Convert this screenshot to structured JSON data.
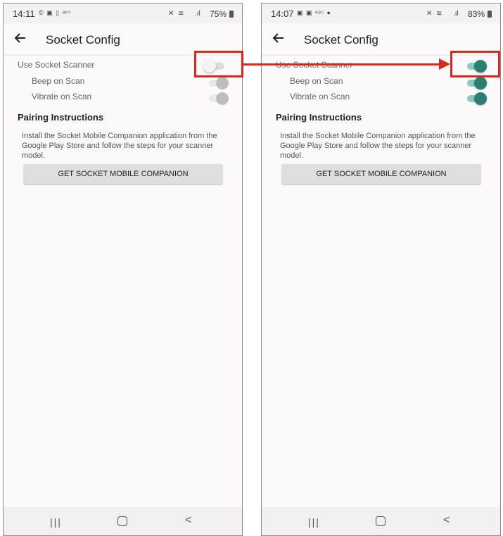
{
  "left": {
    "status": {
      "time": "14:11",
      "battery": "75%",
      "left_icons": "© ▣ ▯ ᵃᵖᶜ"
    },
    "toggles": {
      "use_scanner": "off",
      "beep": "disabled",
      "vibrate": "disabled"
    }
  },
  "right": {
    "status": {
      "time": "14:07",
      "battery": "83%",
      "left_icons": "▣ ▣ ᵃᵖᶜ ●"
    },
    "toggles": {
      "use_scanner": "on",
      "beep": "on",
      "vibrate": "on"
    }
  },
  "appbar": {
    "title": "Socket Config"
  },
  "settings": {
    "use_socket_scanner": "Use Socket Scanner",
    "beep_on_scan": "Beep on Scan",
    "vibrate_on_scan": "Vibrate on Scan"
  },
  "pairing": {
    "title": "Pairing Instructions",
    "text": "Install the Socket Mobile Companion application from the Google Play Store and follow the steps for your scanner model.",
    "button_label": "GET SOCKET MOBILE COMPANION"
  },
  "navbar": {
    "recent": "|||",
    "back": "<"
  },
  "colors": {
    "accent": "#2a8070",
    "highlight": "#d42a1f"
  }
}
